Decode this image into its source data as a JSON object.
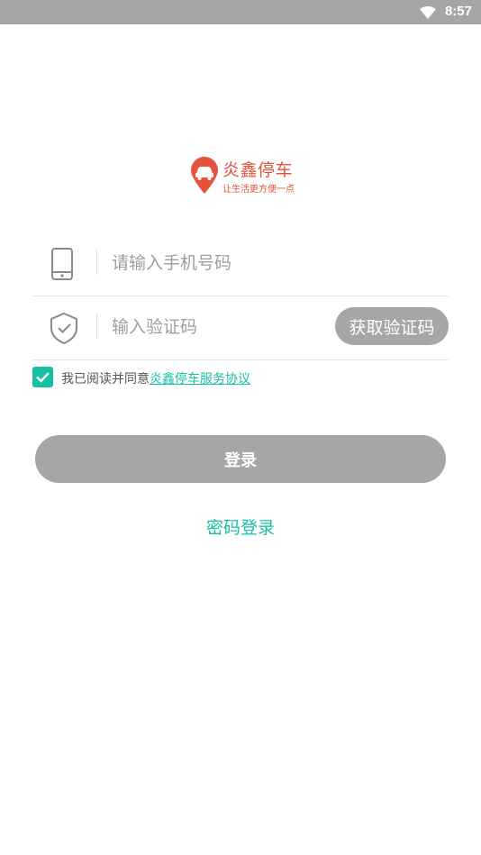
{
  "status_bar": {
    "time": "8:57",
    "wifi_icon": "wifi-icon"
  },
  "logo": {
    "name": "炎鑫停车",
    "slogan": "让生活更方便一点",
    "color": "#e5533a"
  },
  "phone_field": {
    "placeholder": "请输入手机号码",
    "value": "",
    "icon": "phone-icon"
  },
  "code_field": {
    "placeholder": "输入验证码",
    "value": "",
    "icon": "shield-check-icon"
  },
  "get_code_button": {
    "label": "获取验证码"
  },
  "agreement": {
    "checked": true,
    "text": "我已阅读并同意",
    "link": "炎鑫停车服务协议"
  },
  "login_button": {
    "label": "登录"
  },
  "password_login": {
    "label": "密码登录"
  },
  "colors": {
    "accent": "#19bfa5",
    "disabled": "#a6a6a6",
    "brand": "#e5533a"
  }
}
